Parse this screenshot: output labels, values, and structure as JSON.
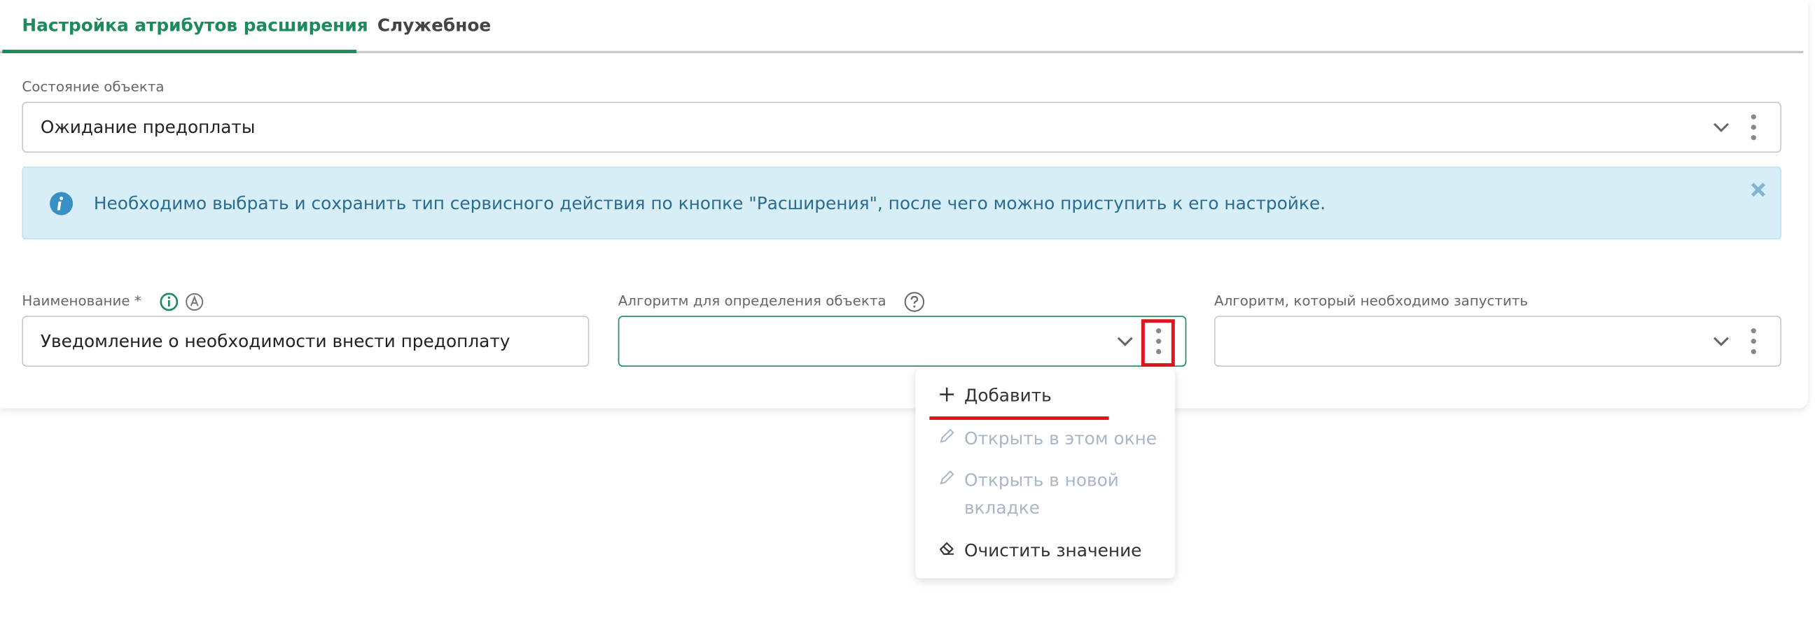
{
  "tabs": [
    {
      "label": "Настройка атрибутов расширения",
      "active": true
    },
    {
      "label": "Служебное",
      "active": false
    }
  ],
  "object_state": {
    "label": "Состояние объекта",
    "value": "Ожидание предоплаты"
  },
  "alert": {
    "text": "Необходимо выбрать и сохранить тип сервисного действия по кнопке \"Расширения\", после чего можно приступить к его настройке.",
    "icon": "info-icon",
    "color": "#d7eef6"
  },
  "name_field": {
    "label": "Наименование *",
    "value": "Уведомление о необходимости внести предоплату"
  },
  "algo_object": {
    "label": "Алгоритм для определения объекта",
    "value": ""
  },
  "algo_run": {
    "label": "Алгоритм, который необходимо запустить",
    "value": ""
  },
  "context_menu": {
    "items": [
      {
        "label": "Добавить",
        "icon": "plus-icon",
        "enabled": true
      },
      {
        "label": "Открыть в этом окне",
        "icon": "pencil-icon",
        "enabled": false
      },
      {
        "label": "Открыть в новой вкладке",
        "line1": "Открыть в новой",
        "line2": "вкладке",
        "icon": "pencil-icon",
        "enabled": false
      },
      {
        "label": "Очистить значение",
        "icon": "eraser-icon",
        "enabled": true
      }
    ]
  },
  "colors": {
    "accent": "#1d8a5c",
    "highlight": "#e0141e",
    "disabled": "#a9b6c6"
  }
}
